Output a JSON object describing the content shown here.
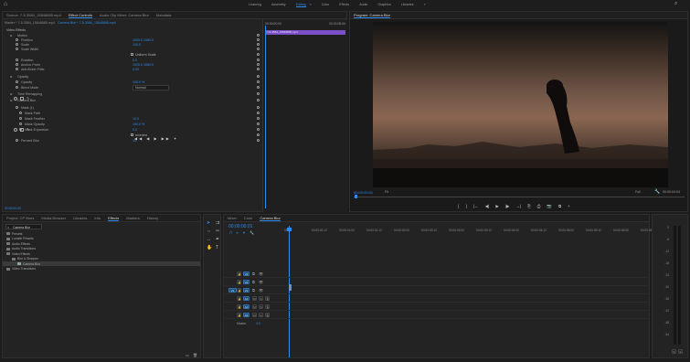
{
  "topnav": {
    "items": [
      "Learning",
      "Assembly",
      "Editing",
      "Color",
      "Effects",
      "Audio",
      "Graphics",
      "Libraries"
    ],
    "active_index": 2,
    "menu_glyph": "≡",
    "more_glyph": "»"
  },
  "colors": {
    "accent": "#2d8ceb",
    "purple_clip": "#7a4fc7",
    "panel_bg": "#232323",
    "app_bg": "#1d1d1d"
  },
  "effect_controls": {
    "tabs": [
      "Source: 7-5-3584_15848885.mp4",
      "Effect Controls",
      "Audio Clip Mixer: Camera Blur",
      "Metadata"
    ],
    "active_tab": 1,
    "master_clip": "Master * 7-5-3584_15848885.mp4",
    "clip_name": "Camera Blur * 7-5-3584_15848885.mp4",
    "section_video": "Video Effects",
    "properties": [
      {
        "name": "Motion",
        "value": "",
        "indent": 1
      },
      {
        "name": "Position",
        "value": "1920.0   1080.0",
        "indent": 2
      },
      {
        "name": "Scale",
        "value": "100.0",
        "indent": 2
      },
      {
        "name": "Scale Width",
        "value": "",
        "indent": 2
      },
      {
        "name": "",
        "value": "Uniform Scale",
        "indent": 2
      },
      {
        "name": "Rotation",
        "value": "0.0",
        "indent": 2
      },
      {
        "name": "Anchor Point",
        "value": "1920.0   1080.0",
        "indent": 2
      },
      {
        "name": "Anti-flicker Filter",
        "value": "0.00",
        "indent": 2
      },
      {
        "name": "Opacity",
        "value": "",
        "indent": 1
      },
      {
        "name": "Opacity",
        "value": "100.0 %",
        "indent": 2
      },
      {
        "name": "Blend Mode",
        "value": "Normal",
        "indent": 2
      },
      {
        "name": "Time Remapping",
        "value": "",
        "indent": 1
      },
      {
        "name": "Camera Blur",
        "value": "",
        "indent": 1
      },
      {
        "name": "Mask (1)",
        "value": "",
        "indent": 2
      },
      {
        "name": "Mask Path",
        "value": "",
        "indent": 3
      },
      {
        "name": "Mask Feather",
        "value": "10.0",
        "indent": 3
      },
      {
        "name": "Mask Opacity",
        "value": "100.0 %",
        "indent": 3
      },
      {
        "name": "Mask Expansion",
        "value": "0.0",
        "indent": 3
      },
      {
        "name": "",
        "value": "Inverted",
        "indent": 3
      },
      {
        "name": "Percent Blur",
        "value": "10",
        "indent": 2
      }
    ],
    "timecode": "00:00:00:00",
    "timecode_end": "00:00:05:00",
    "clip_label": "7-5-3584_15848885.mp4"
  },
  "program": {
    "title": "Program: Camera Blur",
    "timecode": "00:00:00:01",
    "fit": "Fit",
    "quality": "Full",
    "duration": "00:00:04:04",
    "transport": [
      "{",
      "}",
      "|←",
      "◀|",
      "▶",
      "|▶",
      "→|",
      "⎘",
      "⎙",
      "📷",
      "⧉",
      "+"
    ]
  },
  "bottom_left": {
    "tabs": [
      "Project: CP Blurs",
      "Media Browser",
      "Libraries",
      "Info",
      "Effects",
      "Markers",
      "History"
    ],
    "active_tab": 4,
    "search_value": "Camera Blur",
    "tree": [
      {
        "label": "Presets",
        "indent": 0
      },
      {
        "label": "Lumetri Presets",
        "indent": 0
      },
      {
        "label": "Audio Effects",
        "indent": 0
      },
      {
        "label": "Audio Transitions",
        "indent": 0
      },
      {
        "label": "Video Effects",
        "indent": 0
      },
      {
        "label": "Blur & Sharpen",
        "indent": 1
      },
      {
        "label": "Camera Blur",
        "indent": 2
      },
      {
        "label": "Video Transitions",
        "indent": 0
      }
    ],
    "status": "Workspace"
  },
  "timeline": {
    "tabs": [
      "Mixer",
      "Color",
      "Camera Blur"
    ],
    "active_tab": 2,
    "timecode": "00:00:00:01",
    "ruler": [
      "00:00",
      "00:00:00:12",
      "00:00:01:00",
      "00:00:01:12",
      "00:00:02:00",
      "00:00:02:12",
      "00:00:03:00",
      "00:00:03:12",
      "00:00:04:00",
      "00:00:04:12",
      "00:00:05:00",
      "00:00:05:12",
      "00:00:06:00",
      "00:00:06:12"
    ],
    "tracks": [
      {
        "name": "V3",
        "type": "video"
      },
      {
        "name": "V2",
        "type": "video"
      },
      {
        "name": "V1",
        "type": "video",
        "source": "V1"
      },
      {
        "name": "A1",
        "type": "audio"
      },
      {
        "name": "A2",
        "type": "audio"
      },
      {
        "name": "A3",
        "type": "audio"
      }
    ],
    "master_label": "Master",
    "master_value": "0.0",
    "clip_fx": "fx"
  },
  "audio_meter": {
    "scale": [
      "0",
      "-6",
      "-12",
      "-18",
      "-24",
      "-30",
      "-36",
      "-42",
      "-48",
      "-54"
    ],
    "footer": [
      "S",
      "S"
    ]
  }
}
